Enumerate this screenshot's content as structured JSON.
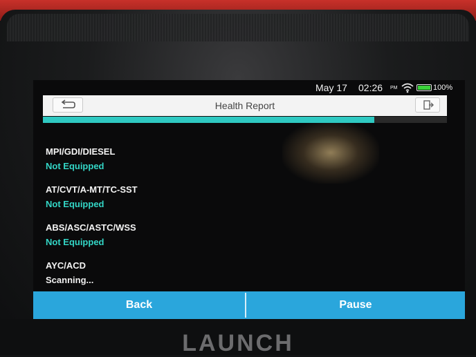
{
  "device": {
    "brand": "LAUNCH"
  },
  "status_bar": {
    "date": "May 17",
    "time": "02:26",
    "ampm": "PM",
    "battery": "100%"
  },
  "header": {
    "title": "Health Report"
  },
  "progress": {
    "fraction": 0.82,
    "color": "#2fc9c2"
  },
  "systems": [
    {
      "name": "MPI/GDI/DIESEL",
      "status": "Not Equipped"
    },
    {
      "name": "AT/CVT/A-MT/TC-SST",
      "status": "Not Equipped"
    },
    {
      "name": "ABS/ASC/ASTC/WSS",
      "status": "Not Equipped"
    },
    {
      "name": "AYC/ACD",
      "status": "Scanning..."
    }
  ],
  "actions": {
    "back_label": "Back",
    "pause_label": "Pause"
  },
  "colors": {
    "accent": "#2aa6dc",
    "status_ok": "#33d6c6"
  }
}
